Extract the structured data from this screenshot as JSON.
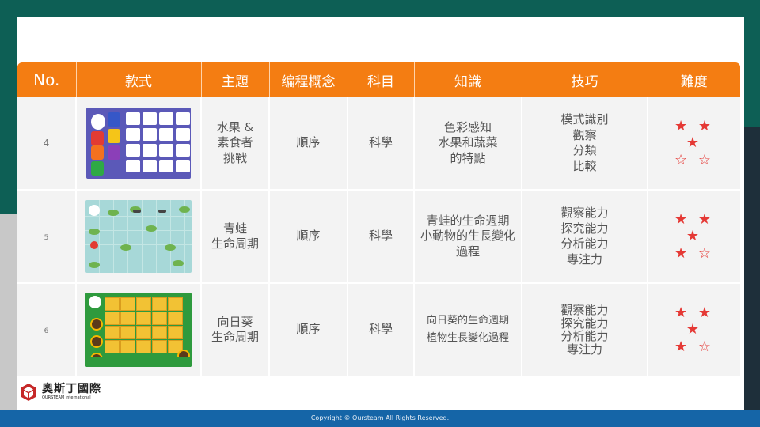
{
  "header": {
    "no": "No.",
    "style": "款式",
    "theme": "主題",
    "programming": "编程概念",
    "subject": "科目",
    "knowledge": "知識",
    "skills": "技巧",
    "difficulty": "難度"
  },
  "rows": [
    {
      "no": "4",
      "theme": "水果 &\n素食者\n挑戰",
      "programming": "順序",
      "subject": "科學",
      "knowledge": "色彩感知\n水果和蔬菜\n的特點",
      "skills": "模式識別\n觀察\n分類\n比較",
      "stars_line1": "★ ★ ★",
      "stars_line2": "☆ ☆",
      "difficulty_rating": 3
    },
    {
      "no": "5",
      "theme": "青蛙\n生命周期",
      "programming": "順序",
      "subject": "科學",
      "knowledge": "青蛙的生命週期\n小動物的生長變化過程",
      "skills": "觀察能力\n探究能力\n分析能力\n專注力",
      "stars_line1": "★ ★ ★",
      "stars_line2": "★ ☆",
      "difficulty_rating": 4
    },
    {
      "no": "6",
      "theme": "向日葵\n生命周期",
      "programming": "順序",
      "subject": "科學",
      "knowledge": "向日葵的生命週期\n植物生長變化過程",
      "skills": "觀察能力\n探究能力\n分析能力\n專注力",
      "stars_line1": "★ ★ ★",
      "stars_line2": "★ ☆",
      "difficulty_rating": 4
    }
  ],
  "logo": {
    "cn": "奧斯丁國際",
    "en": "OURSTEAM International"
  },
  "footer": {
    "copyright": "Copyright © Oursteam All Rights Reserved."
  },
  "colors": {
    "header_orange": "#f47d12",
    "star_red": "#e53935",
    "footer_blue": "#1565a7",
    "background_teal": "#0d5f55"
  },
  "icons": [
    "star-filled-icon",
    "star-outline-icon",
    "logo-cube-icon"
  ]
}
